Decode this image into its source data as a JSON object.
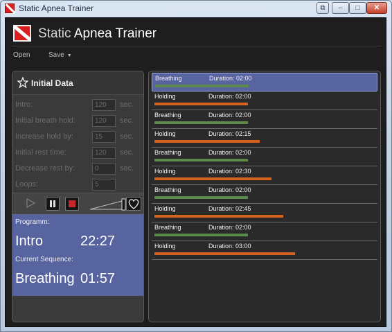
{
  "window": {
    "title": "Static Apnea Trainer",
    "minimize_glyph": "–",
    "maximize_glyph": "□",
    "close_glyph": "✕",
    "extra_glyph": "⧉"
  },
  "app": {
    "heading_light": "Static",
    "heading_bold": "Apnea Trainer",
    "brand_icon": "diver-down-flag-icon"
  },
  "menu": {
    "open_label": "Open",
    "save_label": "Save",
    "save_caret": "▼"
  },
  "initial_data": {
    "title": "Initial Data",
    "fields": [
      {
        "label": "Intro:",
        "value": "120",
        "unit": "sec."
      },
      {
        "label": "Initial breath hold:",
        "value": "120",
        "unit": "sec."
      },
      {
        "label": "Increase hold by:",
        "value": "15",
        "unit": "sec."
      },
      {
        "label": "Initial rest time:",
        "value": "120",
        "unit": "sec."
      },
      {
        "label": "Decrease rest by:",
        "value": "0",
        "unit": "sec."
      },
      {
        "label": "Loops:",
        "value": "5",
        "unit": ""
      }
    ]
  },
  "status": {
    "program_caption": "Programm:",
    "program_name": "Intro",
    "program_time": "22:27",
    "sequence_caption": "Current Sequence:",
    "sequence_name": "Breathing",
    "sequence_time": "01:57"
  },
  "sequence": {
    "colors": {
      "Breathing": "#5b8a4c",
      "Holding": "#d2621d"
    },
    "items": [
      {
        "type": "Breathing",
        "duration": "Duration: 02:00",
        "seconds": 120,
        "selected": true
      },
      {
        "type": "Holding",
        "duration": "Duration: 02:00",
        "seconds": 120
      },
      {
        "type": "Breathing",
        "duration": "Duration: 02:00",
        "seconds": 120
      },
      {
        "type": "Holding",
        "duration": "Duration: 02:15",
        "seconds": 135
      },
      {
        "type": "Breathing",
        "duration": "Duration: 02:00",
        "seconds": 120
      },
      {
        "type": "Holding",
        "duration": "Duration: 02:30",
        "seconds": 150
      },
      {
        "type": "Breathing",
        "duration": "Duration: 02:00",
        "seconds": 120
      },
      {
        "type": "Holding",
        "duration": "Duration: 02:45",
        "seconds": 165
      },
      {
        "type": "Breathing",
        "duration": "Duration: 02:00",
        "seconds": 120
      },
      {
        "type": "Holding",
        "duration": "Duration: 03:00",
        "seconds": 180
      }
    ]
  }
}
